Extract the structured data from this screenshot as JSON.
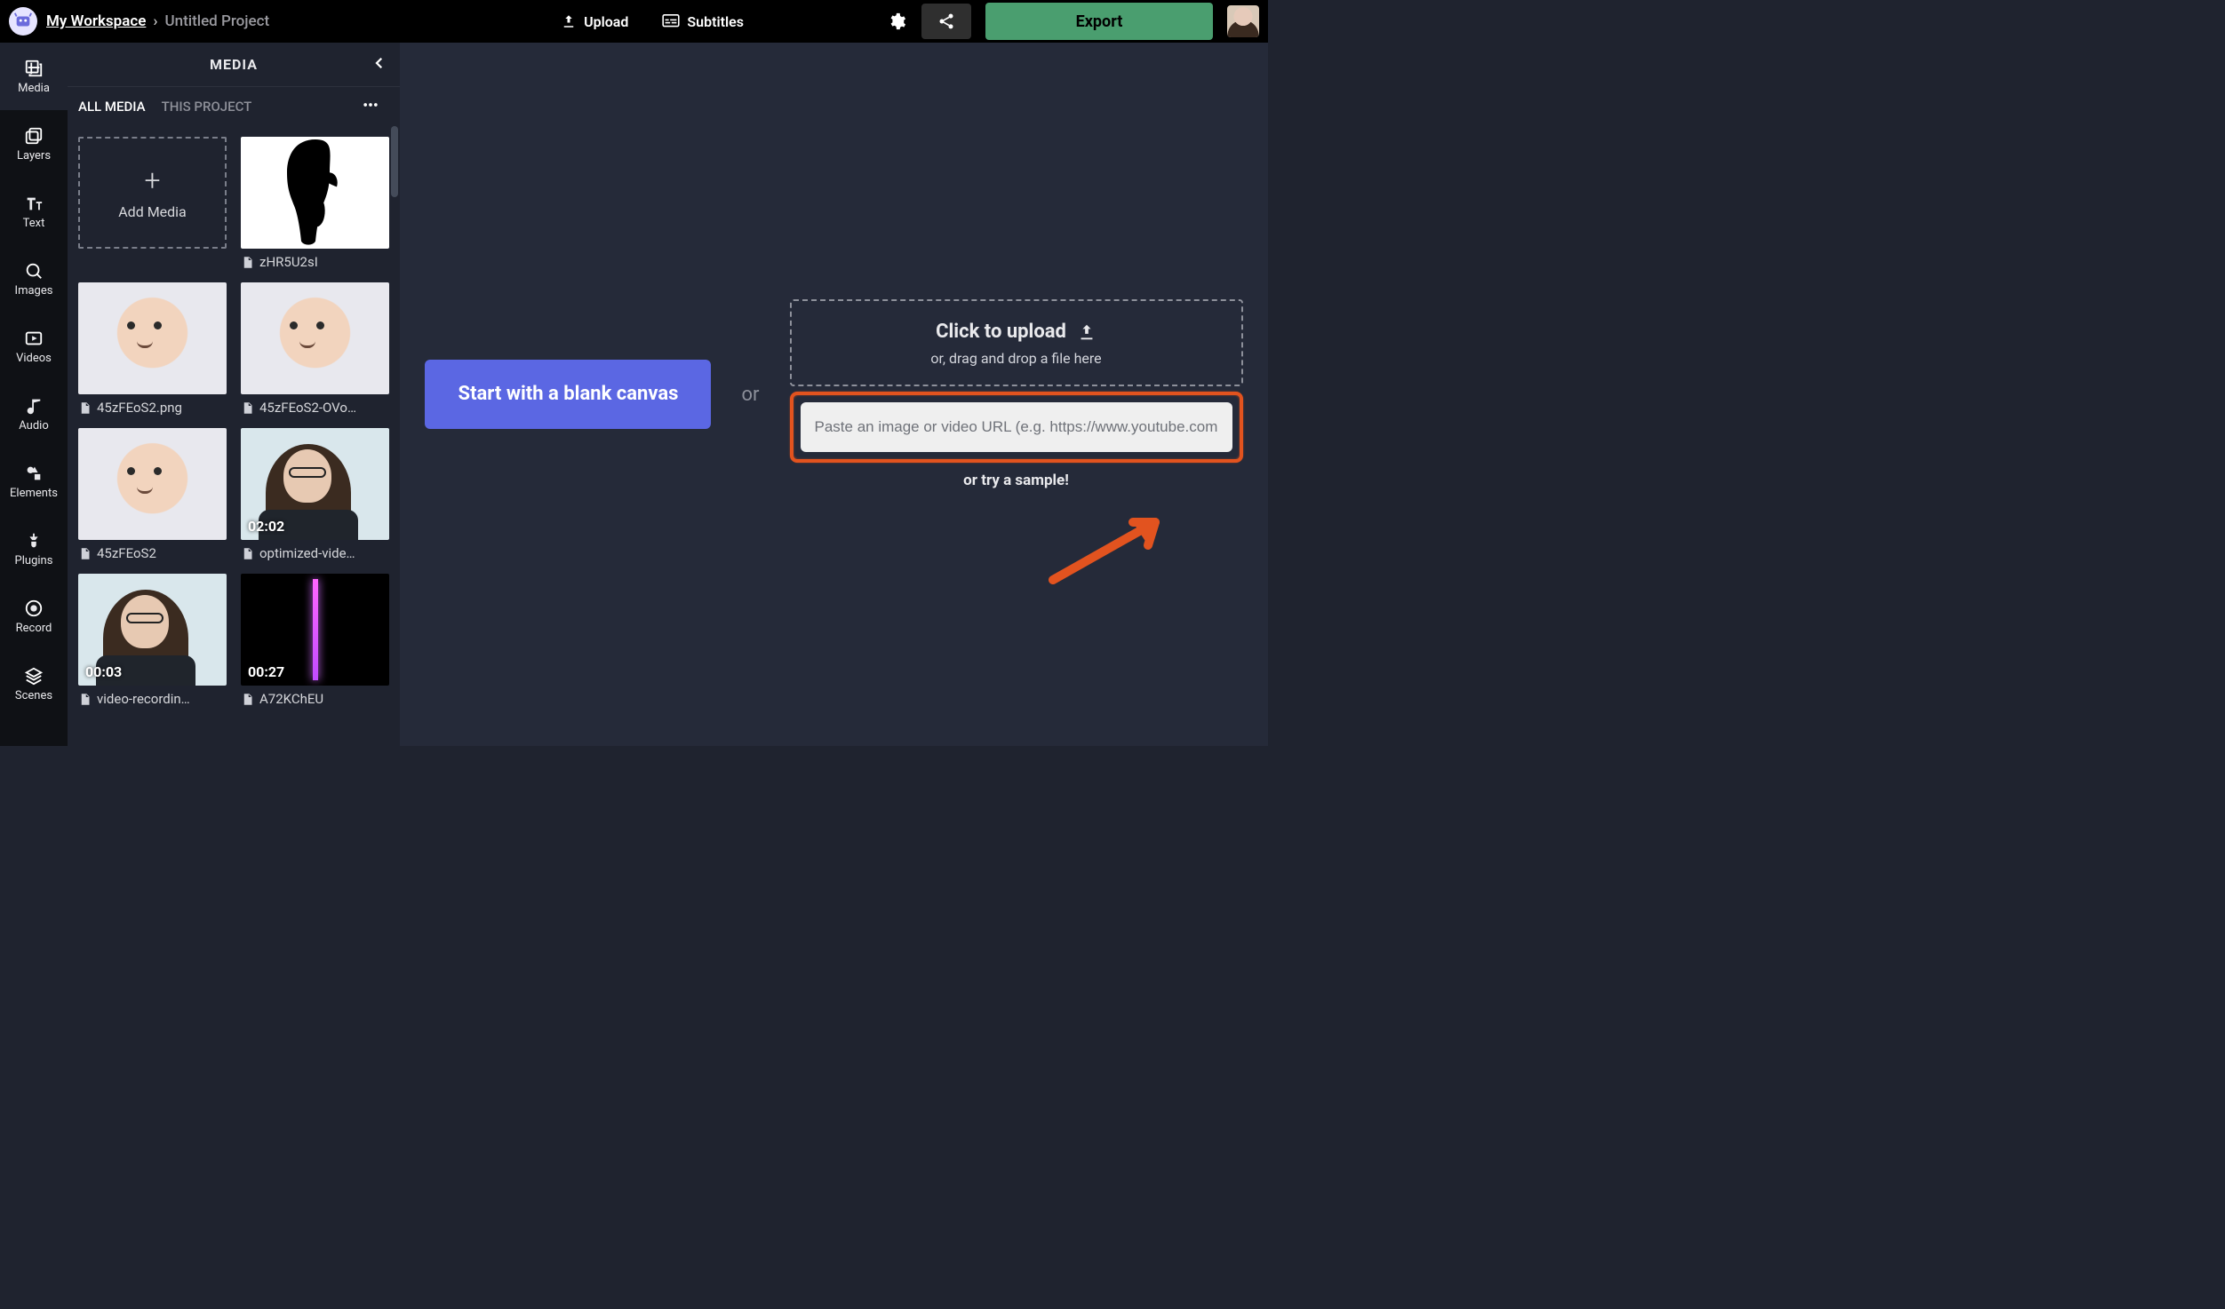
{
  "topbar": {
    "workspace": "My Workspace",
    "separator": "›",
    "project": "Untitled Project",
    "upload_label": "Upload",
    "subtitles_label": "Subtitles",
    "export_label": "Export"
  },
  "rail": {
    "items": [
      {
        "label": "Media",
        "icon": "media"
      },
      {
        "label": "Layers",
        "icon": "layers"
      },
      {
        "label": "Text",
        "icon": "text"
      },
      {
        "label": "Images",
        "icon": "images"
      },
      {
        "label": "Videos",
        "icon": "videos"
      },
      {
        "label": "Audio",
        "icon": "audio"
      },
      {
        "label": "Elements",
        "icon": "elements"
      },
      {
        "label": "Plugins",
        "icon": "plugins"
      },
      {
        "label": "Record",
        "icon": "record"
      },
      {
        "label": "Scenes",
        "icon": "scenes"
      }
    ],
    "active_index": 0
  },
  "panel": {
    "title": "MEDIA",
    "tabs": {
      "all": "ALL MEDIA",
      "project": "THIS PROJECT",
      "active": "all"
    },
    "add_label": "Add Media",
    "items": [
      {
        "name": "zHR5U2sI",
        "kind": "image",
        "thumb": "scream"
      },
      {
        "name": "45zFEoS2.png",
        "kind": "image",
        "thumb": "baby"
      },
      {
        "name": "45zFEoS2-OVo…",
        "kind": "image",
        "thumb": "baby"
      },
      {
        "name": "45zFEoS2",
        "kind": "image",
        "thumb": "baby"
      },
      {
        "name": "optimized-vide…",
        "kind": "video",
        "thumb": "woman",
        "duration": "02:02"
      },
      {
        "name": "video-recordin…",
        "kind": "video",
        "thumb": "woman",
        "duration": "00:03"
      },
      {
        "name": "A72KChEU",
        "kind": "video",
        "thumb": "saber",
        "duration": "00:27"
      }
    ]
  },
  "stage": {
    "blank_button": "Start with a blank canvas",
    "or": "or",
    "upload_title": "Click to upload",
    "upload_sub": "or, drag and drop a file here",
    "url_placeholder": "Paste an image or video URL (e.g. https://www.youtube.com",
    "sample": "or try a sample!"
  }
}
